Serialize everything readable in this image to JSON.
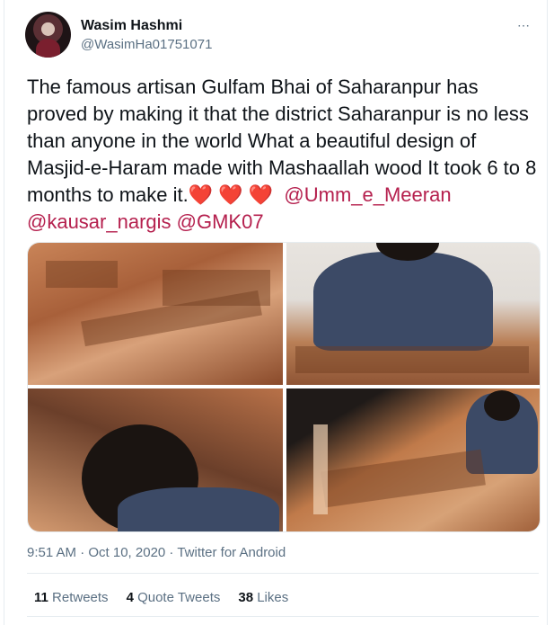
{
  "user": {
    "name": "Wasim Hashmi",
    "handle": "@WasimHa01751071"
  },
  "more_label": "⋯",
  "tweet": {
    "text": "The famous artisan Gulfam Bhai of Saharanpur has proved by making it that the district Saharanpur is no less than anyone in the world What a beautiful design of Masjid-e-Haram made with Mashaallah wood It took 6 to 8 months to make it.",
    "hearts": "❤️ ❤️ ❤️",
    "mentions": [
      "@Umm_e_Meeran",
      "@kausar_nargis",
      "@GMK07"
    ]
  },
  "meta": {
    "time": "9:51 AM · Oct 10, 2020 · Twitter for Android"
  },
  "stats": {
    "retweets_count": "11",
    "retweets_label": "Retweets",
    "quotes_count": "4",
    "quotes_label": "Quote Tweets",
    "likes_count": "38",
    "likes_label": "Likes"
  },
  "colors": {
    "mention": "#b5204e",
    "muted": "#5b7083",
    "border": "#e6ecf0"
  }
}
